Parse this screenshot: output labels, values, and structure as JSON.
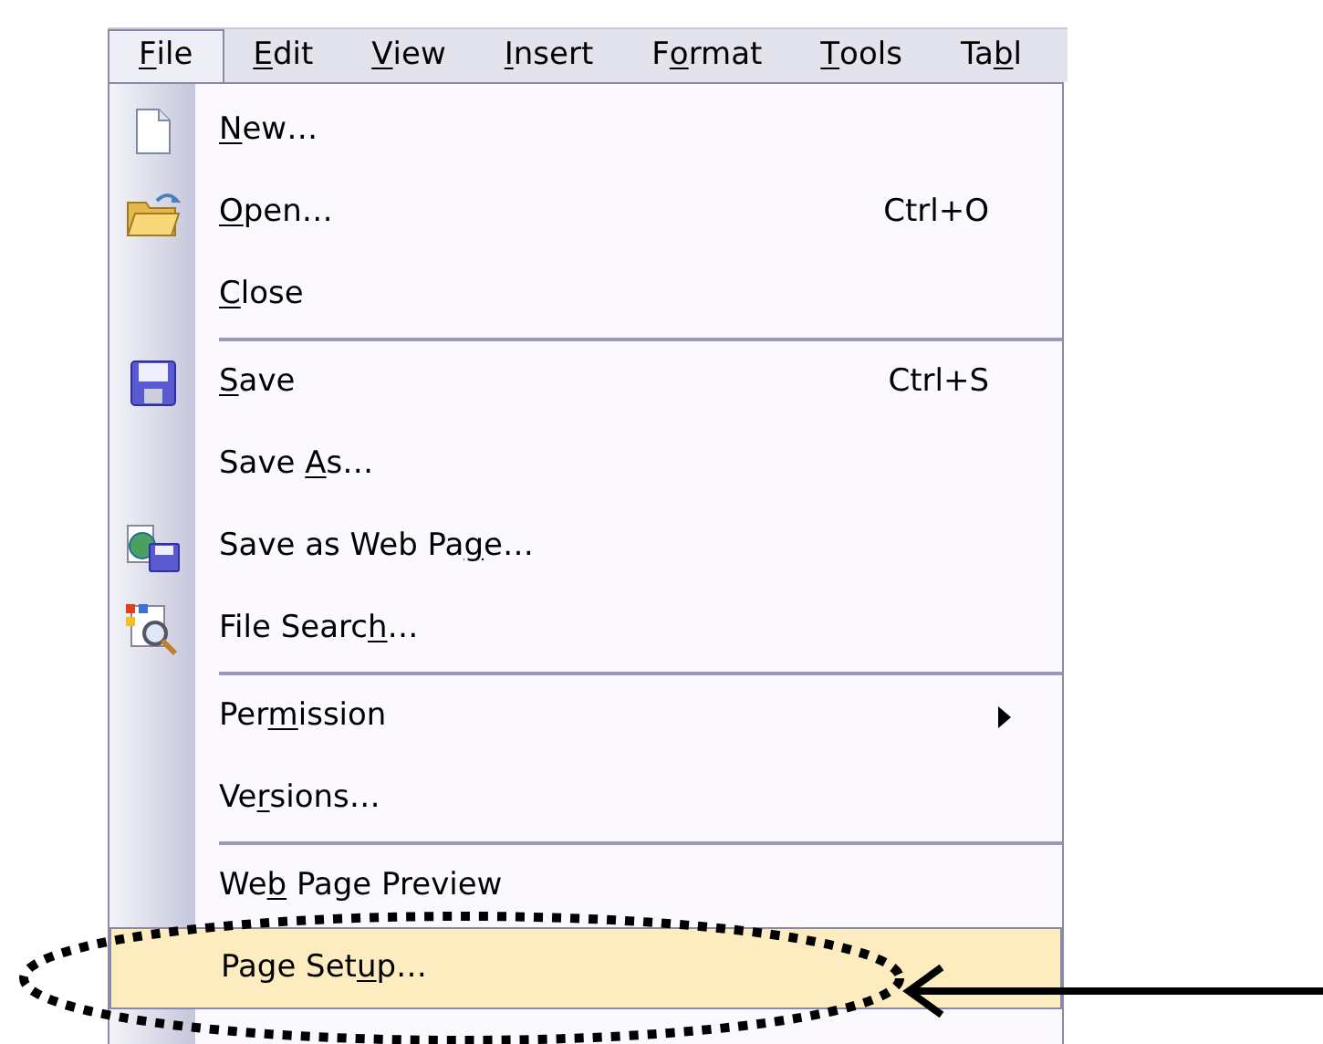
{
  "menu_bar": [
    {
      "key": "F",
      "post": "ile",
      "selected": true
    },
    {
      "key": "E",
      "post": "dit",
      "selected": false
    },
    {
      "key": "V",
      "post": "iew",
      "selected": false
    },
    {
      "key": "I",
      "post": "nsert",
      "selected": false
    },
    {
      "pre": "F",
      "key": "o",
      "post": "rmat",
      "selected": false
    },
    {
      "key": "T",
      "post": "ools",
      "selected": false
    },
    {
      "pre": "Ta",
      "key": "b",
      "post": "l",
      "selected": false
    }
  ],
  "file_menu": [
    {
      "kind": "item",
      "label": {
        "key": "N",
        "post": "ew…"
      },
      "selected": false
    },
    {
      "kind": "item",
      "label": {
        "key": "O",
        "post": "pen…"
      },
      "shortcut": "Ctrl+O",
      "selected": false
    },
    {
      "kind": "item",
      "label": {
        "key": "C",
        "post": "lose"
      },
      "selected": false
    },
    {
      "kind": "separator"
    },
    {
      "kind": "item",
      "label": {
        "key": "S",
        "post": "ave"
      },
      "shortcut": "Ctrl+S",
      "selected": false
    },
    {
      "kind": "item",
      "label": {
        "pre": "Save ",
        "key": "A",
        "post": "s…"
      },
      "selected": false
    },
    {
      "kind": "item",
      "label": {
        "pre": "Save as Web Pa",
        "key": "g",
        "post": "e…"
      },
      "selected": false
    },
    {
      "kind": "item",
      "label": {
        "pre": "File Searc",
        "key": "h",
        "post": "…"
      },
      "selected": false
    },
    {
      "kind": "separator"
    },
    {
      "kind": "item",
      "label": {
        "pre": "Per",
        "key": "m",
        "post": "ission"
      },
      "submenu": true,
      "selected": false
    },
    {
      "kind": "item",
      "label": {
        "pre": "Ve",
        "key": "r",
        "post": "sions…"
      },
      "selected": false
    },
    {
      "kind": "separator"
    },
    {
      "kind": "item",
      "label": {
        "pre": "We",
        "key": "b",
        "post": " Page Preview"
      },
      "selected": false
    },
    {
      "kind": "item",
      "label": {
        "pre": "Page Set",
        "key": "u",
        "post": "p…"
      },
      "selected": true
    }
  ]
}
